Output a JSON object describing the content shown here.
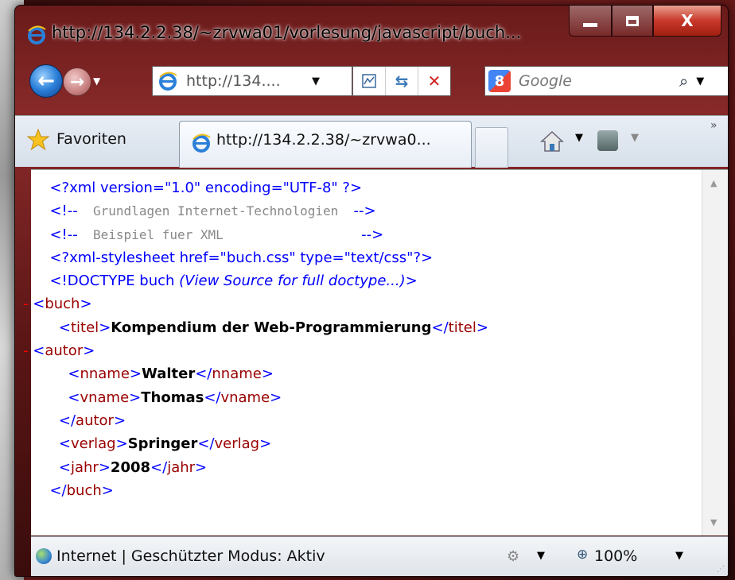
{
  "window": {
    "title": "http://134.2.2.38/~zrvwa01/vorlesung/javascript/buch...",
    "minimize_label": "",
    "maximize_label": "",
    "close_label": "X"
  },
  "nav": {
    "back_glyph": "←",
    "forward_glyph": "→",
    "address_text": "http://134....",
    "search_placeholder": "Google"
  },
  "tabs": {
    "favorites_label": "Favoriten",
    "active_tab_title": "http://134.2.2.38/~zrvwa0..."
  },
  "xml_lines": [
    {
      "indent": "",
      "parts": [
        {
          "c": "pi",
          "t": "<?xml version=\"1.0\" encoding=\"UTF-8\" ?>"
        }
      ]
    },
    {
      "indent": "",
      "parts": [
        {
          "c": "cmk",
          "t": "<!--"
        },
        {
          "c": "cm",
          "t": "  Grundlagen Internet-Technologien  "
        },
        {
          "c": "cmk",
          "t": "-->"
        }
      ]
    },
    {
      "indent": "",
      "parts": [
        {
          "c": "cmk",
          "t": "<!--"
        },
        {
          "c": "cm",
          "t": "  Beispiel fuer XML                  "
        },
        {
          "c": "cmk",
          "t": "-->"
        }
      ]
    },
    {
      "indent": "",
      "parts": [
        {
          "c": "pi",
          "t": "<?xml-stylesheet href=\"buch.css\" type=\"text/css\"?>"
        }
      ]
    },
    {
      "indent": "",
      "parts": [
        {
          "c": "pi",
          "t": "<!DOCTYPE buch "
        },
        {
          "c": "em",
          "t": "(View Source for full doctype...)"
        },
        {
          "c": "pi",
          "t": ">"
        }
      ]
    },
    {
      "indent": "",
      "minus": true,
      "parts": [
        {
          "c": "tagb",
          "t": "<"
        },
        {
          "c": "tagn",
          "t": "buch"
        },
        {
          "c": "tagb",
          "t": ">"
        }
      ]
    },
    {
      "indent": "  ",
      "parts": [
        {
          "c": "tagb",
          "t": "<"
        },
        {
          "c": "tagn",
          "t": "titel"
        },
        {
          "c": "tagb",
          "t": ">"
        },
        {
          "c": "txt",
          "t": "Kompendium der Web-Programmierung"
        },
        {
          "c": "tagb",
          "t": "</"
        },
        {
          "c": "tagn",
          "t": "titel"
        },
        {
          "c": "tagb",
          "t": ">"
        }
      ]
    },
    {
      "indent": "",
      "minus": true,
      "parts": [
        {
          "c": "tagb",
          "t": "<"
        },
        {
          "c": "tagn",
          "t": "autor"
        },
        {
          "c": "tagb",
          "t": ">"
        }
      ]
    },
    {
      "indent": "    ",
      "parts": [
        {
          "c": "tagb",
          "t": "<"
        },
        {
          "c": "tagn",
          "t": "nname"
        },
        {
          "c": "tagb",
          "t": ">"
        },
        {
          "c": "txt",
          "t": "Walter"
        },
        {
          "c": "tagb",
          "t": "</"
        },
        {
          "c": "tagn",
          "t": "nname"
        },
        {
          "c": "tagb",
          "t": ">"
        }
      ]
    },
    {
      "indent": "    ",
      "parts": [
        {
          "c": "tagb",
          "t": "<"
        },
        {
          "c": "tagn",
          "t": "vname"
        },
        {
          "c": "tagb",
          "t": ">"
        },
        {
          "c": "txt",
          "t": "Thomas"
        },
        {
          "c": "tagb",
          "t": "</"
        },
        {
          "c": "tagn",
          "t": "vname"
        },
        {
          "c": "tagb",
          "t": ">"
        }
      ]
    },
    {
      "indent": "  ",
      "parts": [
        {
          "c": "tagb",
          "t": "</"
        },
        {
          "c": "tagn",
          "t": "autor"
        },
        {
          "c": "tagb",
          "t": ">"
        }
      ]
    },
    {
      "indent": "  ",
      "parts": [
        {
          "c": "tagb",
          "t": "<"
        },
        {
          "c": "tagn",
          "t": "verlag"
        },
        {
          "c": "tagb",
          "t": ">"
        },
        {
          "c": "txt",
          "t": "Springer"
        },
        {
          "c": "tagb",
          "t": "</"
        },
        {
          "c": "tagn",
          "t": "verlag"
        },
        {
          "c": "tagb",
          "t": ">"
        }
      ]
    },
    {
      "indent": "  ",
      "parts": [
        {
          "c": "tagb",
          "t": "<"
        },
        {
          "c": "tagn",
          "t": "jahr"
        },
        {
          "c": "tagb",
          "t": ">"
        },
        {
          "c": "txt",
          "t": "2008"
        },
        {
          "c": "tagb",
          "t": "</"
        },
        {
          "c": "tagn",
          "t": "jahr"
        },
        {
          "c": "tagb",
          "t": ">"
        }
      ]
    },
    {
      "indent": "",
      "parts": [
        {
          "c": "tagb",
          "t": "</"
        },
        {
          "c": "tagn",
          "t": "buch"
        },
        {
          "c": "tagb",
          "t": ">"
        }
      ]
    }
  ],
  "status": {
    "text": "Internet | Geschützter Modus: Aktiv",
    "zoom": "100%"
  }
}
